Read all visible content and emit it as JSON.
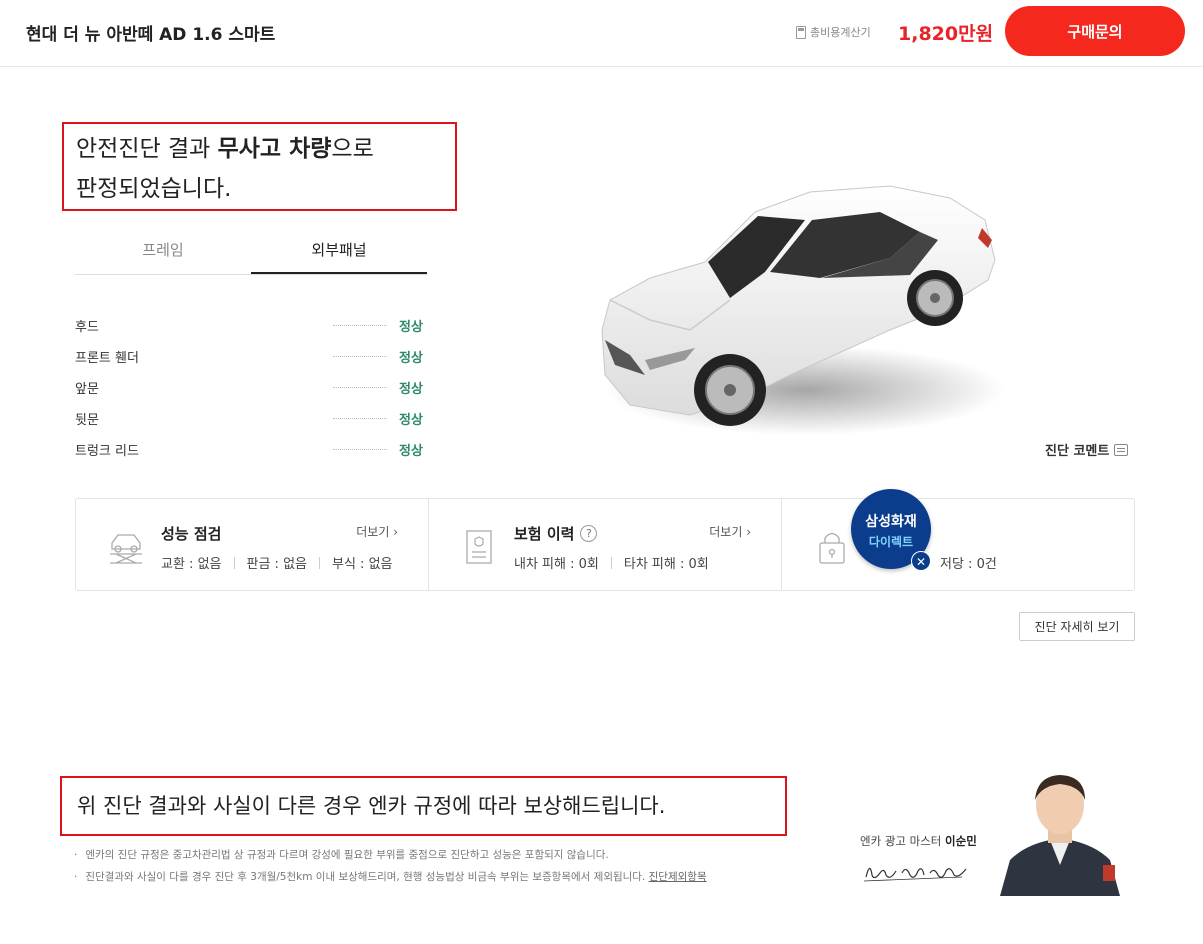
{
  "header": {
    "car_name": "현대 더 뉴 아반떼 AD 1.6 스마트",
    "calc_label": "총비용계산기",
    "price": "1,820만원",
    "buy_label": "구매문의"
  },
  "headline": {
    "line1_prefix": "안전진단 결과 ",
    "line1_bold": "무사고 차량",
    "line1_suffix": "으로",
    "line2": "판정되었습니다."
  },
  "tabs": [
    {
      "label": "프레임",
      "active": false
    },
    {
      "label": "외부패널",
      "active": true
    }
  ],
  "panels": [
    {
      "name": "후드",
      "status": "정상"
    },
    {
      "name": "프론트 휀더",
      "status": "정상"
    },
    {
      "name": "앞문",
      "status": "정상"
    },
    {
      "name": "뒷문",
      "status": "정상"
    },
    {
      "name": "트렁크 리드",
      "status": "정상"
    }
  ],
  "comment_label": "진단 코멘트",
  "cards": {
    "performance": {
      "title": "성능 점검",
      "more": "더보기",
      "items": [
        "교환 : 없음",
        "판금 : 없음",
        "부식 : 없음"
      ]
    },
    "insurance": {
      "title": "보험 이력",
      "help": "?",
      "more": "더보기",
      "items": [
        "내차 피해 : 0회",
        "타차 피해 : 0회"
      ]
    },
    "lien": {
      "items": [
        "저당 : 0건"
      ]
    }
  },
  "badge": {
    "line1": "삼성화재",
    "line2": "다이렉트",
    "close": "✕"
  },
  "detail_button": "진단 자세히 보기",
  "compensation": "위 진단 결과와 사실이 다른 경우 엔카 규정에 따라 보상해드립니다.",
  "notes": {
    "note1": "엔카의 진단 규정은 중고차관리법 상 규정과 다르며 강성에 필요한 부위를 중점으로 진단하고 성능은 포함되지 않습니다.",
    "note2": "진단결과와 사실이 다를 경우 진단 후 3개월/5천km 이내 보상해드리며, 현행 성능법상 비금속 부위는 보증항목에서 제외됩니다.",
    "note2_link": "진단제외항목"
  },
  "master": {
    "label": "엔카 광고 마스터 ",
    "name": "이순민"
  },
  "colors": {
    "accent": "#f5281e",
    "price": "#e8232a",
    "status_ok": "#2d8a6a",
    "highlight_border": "#d9141c",
    "badge": "#0b3d8c"
  }
}
